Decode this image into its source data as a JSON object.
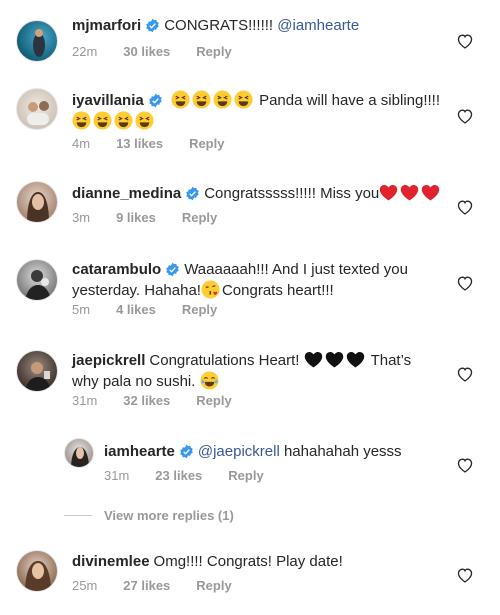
{
  "comments": [
    {
      "username": "mjmarfori",
      "text_pre": "CONGRATS!!!!!!",
      "mention": "@iamhearte",
      "text_post": "",
      "time": "22m",
      "likes": "30 likes",
      "reply": "Reply"
    },
    {
      "username": "iyavillania",
      "text_pre": "",
      "text_line1": "Panda will have a sibling!!!!",
      "time": "4m",
      "likes": "13 likes",
      "reply": "Reply",
      "emoji_count_line1": 4,
      "emoji_count_line2": 4
    },
    {
      "username": "dianne_medina",
      "text_pre": "Congratsssss!!!!! Miss you",
      "time": "3m",
      "likes": "9 likes",
      "reply": "Reply"
    },
    {
      "username": "catarambulo",
      "text_line1": "Waaaaaah!!! And I just texted you",
      "text_line2a": "yesterday. Hahaha!",
      "text_line2b": "Congrats heart!!!",
      "time": "5m",
      "likes": "4 likes",
      "reply": "Reply"
    },
    {
      "username": "jaepickrell",
      "text_line1": "Congratulations Heart!",
      "text_line1b": "That’s",
      "text_line2": "why pala no sushi.",
      "time": "31m",
      "likes": "32 likes",
      "reply": "Reply"
    },
    {
      "username": "iamhearte",
      "mention": "@jaepickrell",
      "text_post": "hahahahah yesss",
      "time": "31m",
      "likes": "23 likes",
      "reply": "Reply"
    },
    {
      "username": "divinemlee",
      "text_pre": "Omg!!!! Congrats! Play date!",
      "time": "25m",
      "likes": "27 likes",
      "reply": "Reply"
    }
  ],
  "view_more": "View more replies (1)",
  "icons": {
    "heart": "heart-outline-icon",
    "verified": "verified-badge-icon"
  },
  "colors": {
    "text": "#262626",
    "meta": "#999999",
    "mention": "#385898",
    "verified": "#3897f0",
    "heart_red": "#e0242d"
  }
}
